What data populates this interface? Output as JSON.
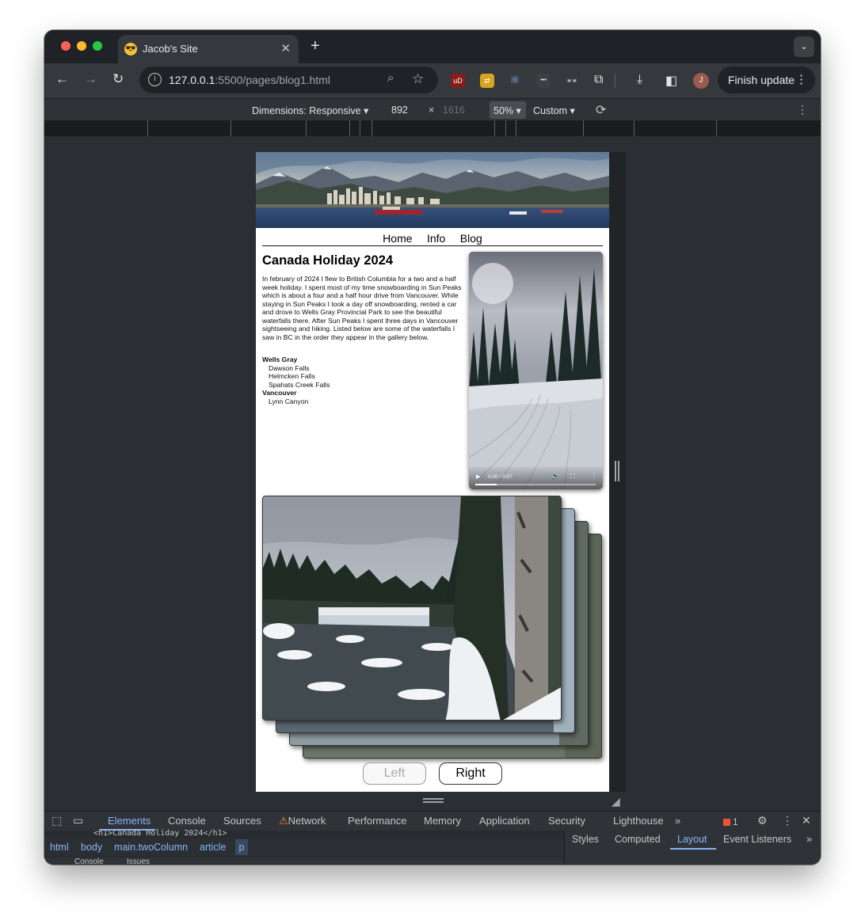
{
  "browser": {
    "tab_title": "Jacob's Site",
    "tab_favicon": "😎",
    "url_host": "127.0.0.1",
    "url_rest": ":5500/pages/blog1.html",
    "profile_initial": "J",
    "finish_update_label": "Finish update",
    "extensions": [
      {
        "name": "ublock-icon",
        "label": "uD",
        "color": "#8a1b1b"
      },
      {
        "name": "google-translate-icon",
        "label": "⇄",
        "color": "#d6a41d"
      },
      {
        "name": "react-devtools-icon",
        "label": "⚛",
        "color": "#35393d"
      },
      {
        "name": "extension-dots-icon",
        "label": "•••",
        "color": "#3c4043"
      },
      {
        "name": "glasses-extension-icon",
        "label": "👓",
        "color": "#35393d"
      }
    ]
  },
  "device_toolbar": {
    "dimensions_label": "Dimensions: Responsive",
    "width": "892",
    "times": "×",
    "height": "1616",
    "zoom": "50%",
    "throttle": "Custom"
  },
  "site": {
    "nav": [
      "Home",
      "Info",
      "Blog"
    ],
    "post_title": "Canada Holiday 2024",
    "post_body": "In february of 2024 I flew to British Columbia for a two and a half week holiday. I spent most of my time snowboarding in Sun Peaks which is about a four and a half hour drive from Vancouver. While staying in Sun Peaks I took a day off snowboarding, rented a car and drove to Wells Gray Provincial Park to see the beautiful waterfalls there. After Sun Peaks I spent three days in Vancouver sightseeing and hiking. Listed below are some of the waterfalls I saw in BC in the order they appear in the gallery below.",
    "waterfall_groups": [
      {
        "region": "Wells Gray",
        "falls": [
          "Dawson Falls",
          "Helmcken Falls",
          "Spahats Creek Falls"
        ]
      },
      {
        "region": "Vancouver",
        "falls": [
          "Lynn Canyon"
        ]
      }
    ],
    "video_time": "0:00 / 0:07",
    "video_progress_fraction": 0.18,
    "gallery_left_label": "Left",
    "gallery_right_label": "Right"
  },
  "devtools": {
    "tabs": [
      "Elements",
      "Console",
      "Sources",
      "Network",
      "Performance",
      "Memory",
      "Application",
      "Security",
      "Lighthouse"
    ],
    "active_tab": "Elements",
    "error_count": "1",
    "code_line": "<h1>Canada Holiday 2024</h1>",
    "breadcrumbs": [
      "html",
      "body",
      "main.twoColumn",
      "article"
    ],
    "breadcrumb_selected": "p",
    "side_tabs": [
      "Styles",
      "Computed",
      "Layout",
      "Event Listeners"
    ],
    "active_side_tab": "Layout",
    "drawer_tabs": [
      "Console",
      "Issues"
    ]
  },
  "colors": {
    "accent": "#8ab4f8",
    "window_bg": "#2b2f33",
    "page_bg": "#ffffff"
  }
}
